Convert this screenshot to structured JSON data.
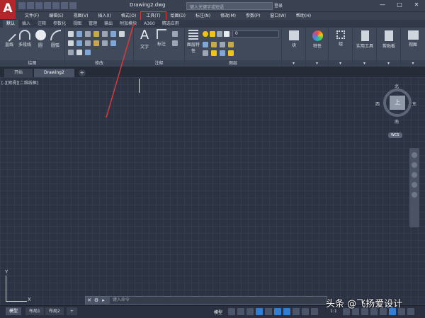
{
  "app": {
    "logo": "A",
    "doc_title": "Drawing2.dwg",
    "search_placeholder": "键入关键字或短语",
    "login": "登录"
  },
  "window_controls": [
    "—",
    "□",
    "✕"
  ],
  "menu": [
    "文件(F)",
    "编辑(E)",
    "视图(V)",
    "插入(I)",
    "格式(O)",
    "工具(T)",
    "绘图(D)",
    "标注(N)",
    "修改(M)",
    "参数(P)",
    "窗口(W)",
    "帮助(H)"
  ],
  "ribbon_tabs": [
    "默认",
    "插入",
    "注释",
    "参数化",
    "视图",
    "管理",
    "输出",
    "附加模块",
    "A360",
    "精选应用"
  ],
  "ribbon": {
    "draw": {
      "label": "绘图",
      "tools": [
        "直线",
        "多段线",
        "圆",
        "圆弧"
      ]
    },
    "modify": {
      "label": "修改"
    },
    "annotation": {
      "label": "注释",
      "tools": [
        "文字",
        "标注"
      ]
    },
    "layers": {
      "label": "图层",
      "tools": [
        "图层特性"
      ],
      "layer_value": "0"
    },
    "block": {
      "label": "块"
    },
    "properties": {
      "label": "特性"
    },
    "group": {
      "label": "组"
    },
    "utilities": {
      "label": "实用工具"
    },
    "clipboard": {
      "label": "剪贴板"
    },
    "view": {
      "label": "视图"
    }
  },
  "doc_tabs": [
    "开始",
    "Drawing2"
  ],
  "viewport": {
    "label": "[-][俯视][二维线框]"
  },
  "viewcube": {
    "top": "上",
    "north": "北",
    "south": "南",
    "east": "东",
    "west": "西",
    "wcs": "WCS"
  },
  "ucs": {
    "x": "X",
    "y": "Y"
  },
  "command": {
    "placeholder": "键入命令"
  },
  "layout_tabs": [
    "模型",
    "布局1",
    "布局2"
  ],
  "status": {
    "model": "模型",
    "scale": "1:1"
  },
  "watermark": "头条 @飞扬爱设计",
  "colors": {
    "highlight": "#d83a3a",
    "accent": "#2f7fd8"
  }
}
